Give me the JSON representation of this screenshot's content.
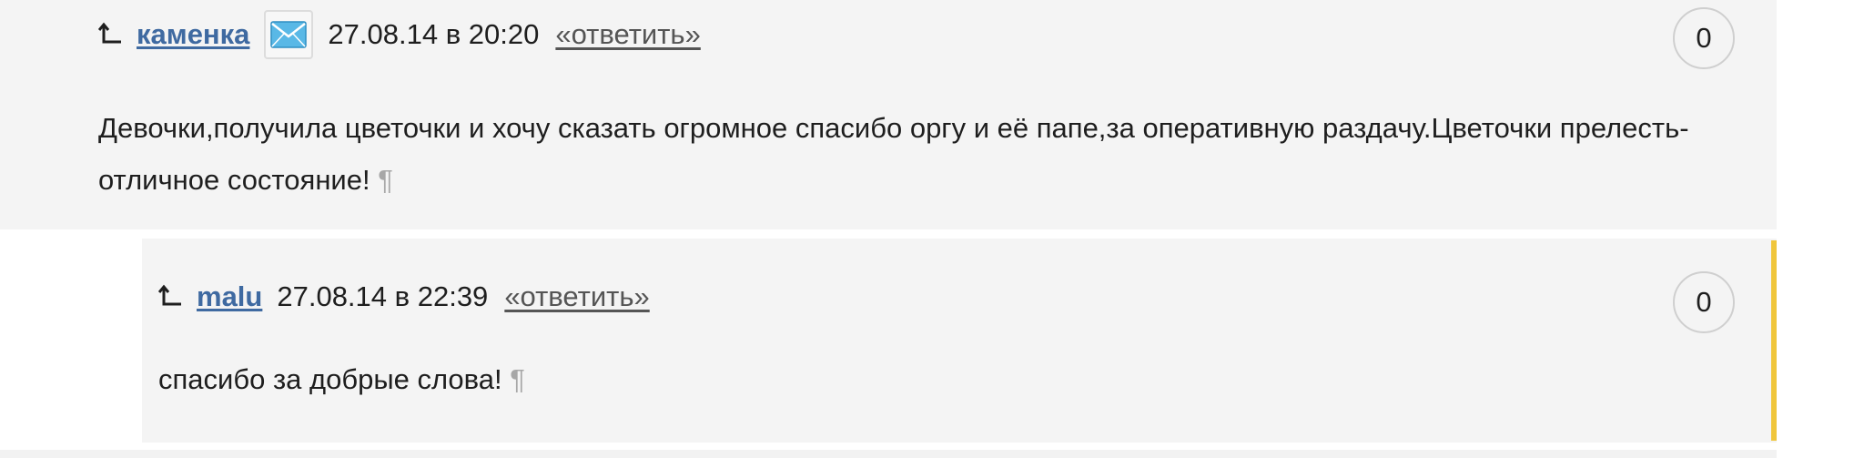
{
  "comments": [
    {
      "author": "каменка",
      "has_mail_icon": true,
      "timestamp": "27.08.14 в 20:20",
      "reply_label": "«ответить»",
      "vote_count": "0",
      "text_line1": "Девочки,получила цветочки и хочу сказать огромное спасибо оргу и её папе,за оперативную раздачу.Цветочки прелесть-",
      "text_line2": "отличное состояние!",
      "pilcrow": "¶"
    },
    {
      "author": "malu",
      "has_mail_icon": false,
      "timestamp": "27.08.14 в 22:39",
      "reply_label": "«ответить»",
      "vote_count": "0",
      "text_line1": "спасибо за добрые слова!",
      "pilcrow": "¶"
    }
  ],
  "colors": {
    "author_link": "#3f6aa1",
    "accent_bar": "#f0c63c",
    "background": "#f4f4f4"
  },
  "icons": {
    "reply_arrow": "reply-arrow-icon",
    "mail": "envelope-icon"
  }
}
